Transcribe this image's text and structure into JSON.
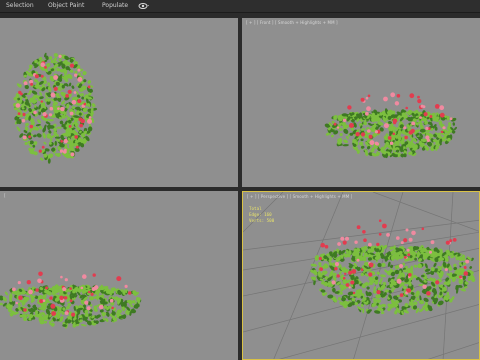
{
  "menu": {
    "items": [
      {
        "label": "Selection"
      },
      {
        "label": "Object Paint"
      },
      {
        "label": "Populate"
      }
    ]
  },
  "viewports": {
    "top": {
      "label": ""
    },
    "front": {
      "label": "[ + ] [ Front ] [ Smooth + Highlights + MM ]"
    },
    "left": {
      "label": "["
    },
    "perspective": {
      "label": "[ + ] [ Perspective ] [ Smooth + Highlights + MM ]",
      "stats": {
        "total": "Total",
        "edges": "Edge: 160",
        "verts": "Verts: 500"
      }
    }
  },
  "colors": {
    "viewport_bg": "#8f8f8f",
    "grid": "#747474",
    "leaf": "#7cbf3f",
    "leaf_dark": "#3e7a22",
    "flower_red": "#e23c4f",
    "flower_pink": "#f08aa0"
  }
}
